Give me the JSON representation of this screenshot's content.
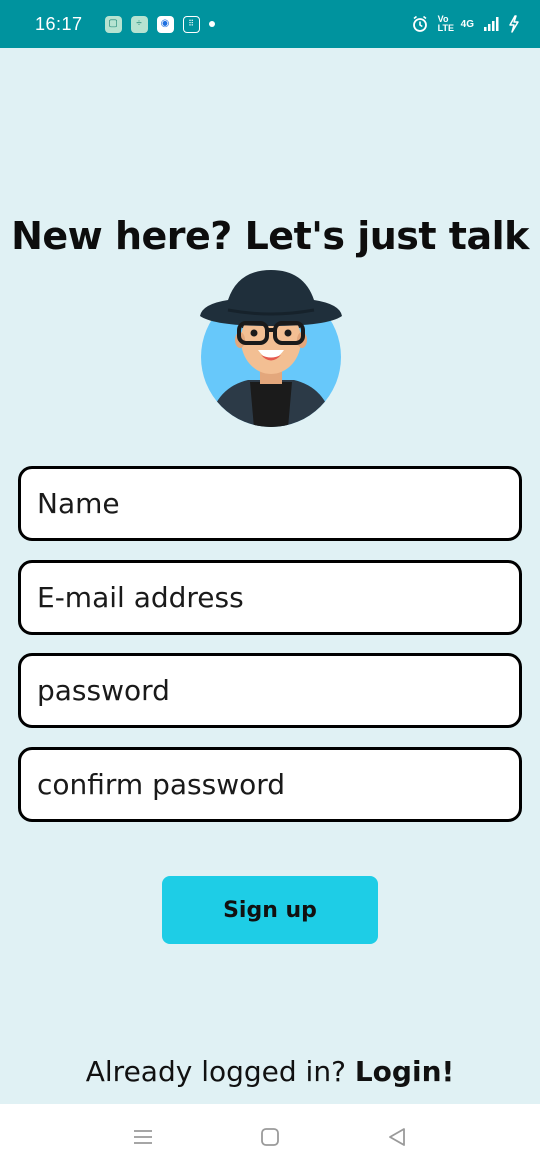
{
  "status_bar": {
    "time": "16:17",
    "network_label": "4G",
    "volte_label": "Vo LTE"
  },
  "heading": "New here? Let's just talk",
  "form": {
    "name_placeholder": "Name",
    "email_placeholder": "E-mail address",
    "password_placeholder": "password",
    "confirm_placeholder": "confirm password",
    "submit_label": "Sign up"
  },
  "footer": {
    "prompt": "Already logged in?",
    "login_link": "Login!"
  },
  "nav": {
    "menu_icon": "menu-icon",
    "home_icon": "home-square-icon",
    "back_icon": "back-triangle-icon"
  },
  "colors": {
    "status_bar": "#00939e",
    "background": "#e0f1f4",
    "button": "#1ecde6"
  }
}
